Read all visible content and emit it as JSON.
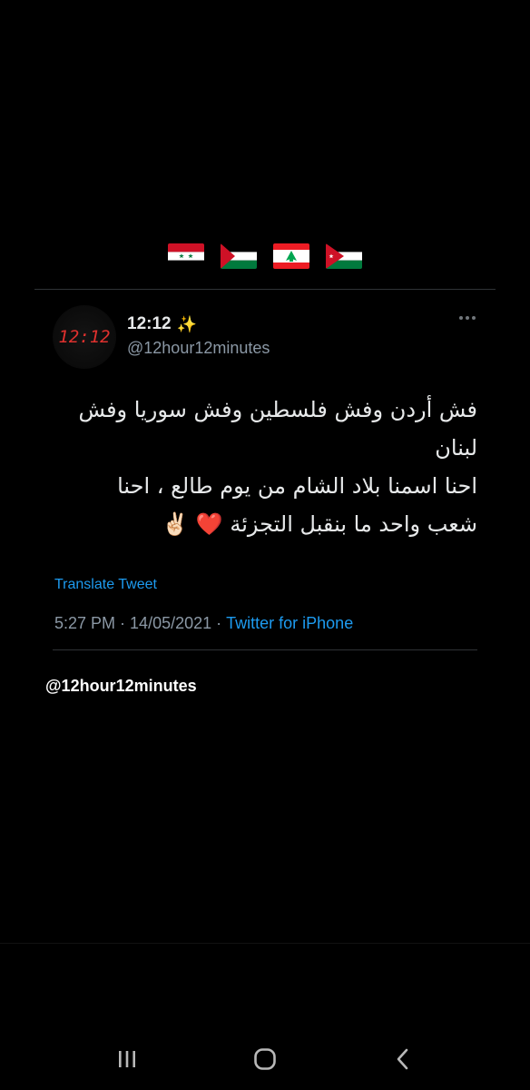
{
  "flags": [
    {
      "name": "syria-flag-icon"
    },
    {
      "name": "palestine-flag-icon"
    },
    {
      "name": "lebanon-flag-icon"
    },
    {
      "name": "jordan-flag-icon"
    }
  ],
  "tweet": {
    "avatar_text": "12:12",
    "display_name": "12:12",
    "sparkle": "✨",
    "handle": "@12hour12minutes",
    "body_lines": [
      "فش أردن وفش فلسطين وفش سوريا وفش",
      "لبنان",
      "احنا اسمنا بلاد الشام من يوم طالع ، احنا",
      "شعب واحد ما بنقبل التجزئة ❤️ ✌🏻"
    ],
    "translate_label": "Translate Tweet",
    "time": "5:27 PM",
    "date": "14/05/2021",
    "separator": "·",
    "source": "Twitter for iPhone"
  },
  "watermark": "@12hour12minutes",
  "colors": {
    "background": "#000000",
    "link": "#1d9bf0",
    "muted": "#8b98a5",
    "text": "#e7e9ea",
    "avatar_digits": "#e0312e"
  },
  "navbar": {
    "recent_icon": "recent-apps-icon",
    "home_icon": "home-icon",
    "back_icon": "back-icon"
  }
}
